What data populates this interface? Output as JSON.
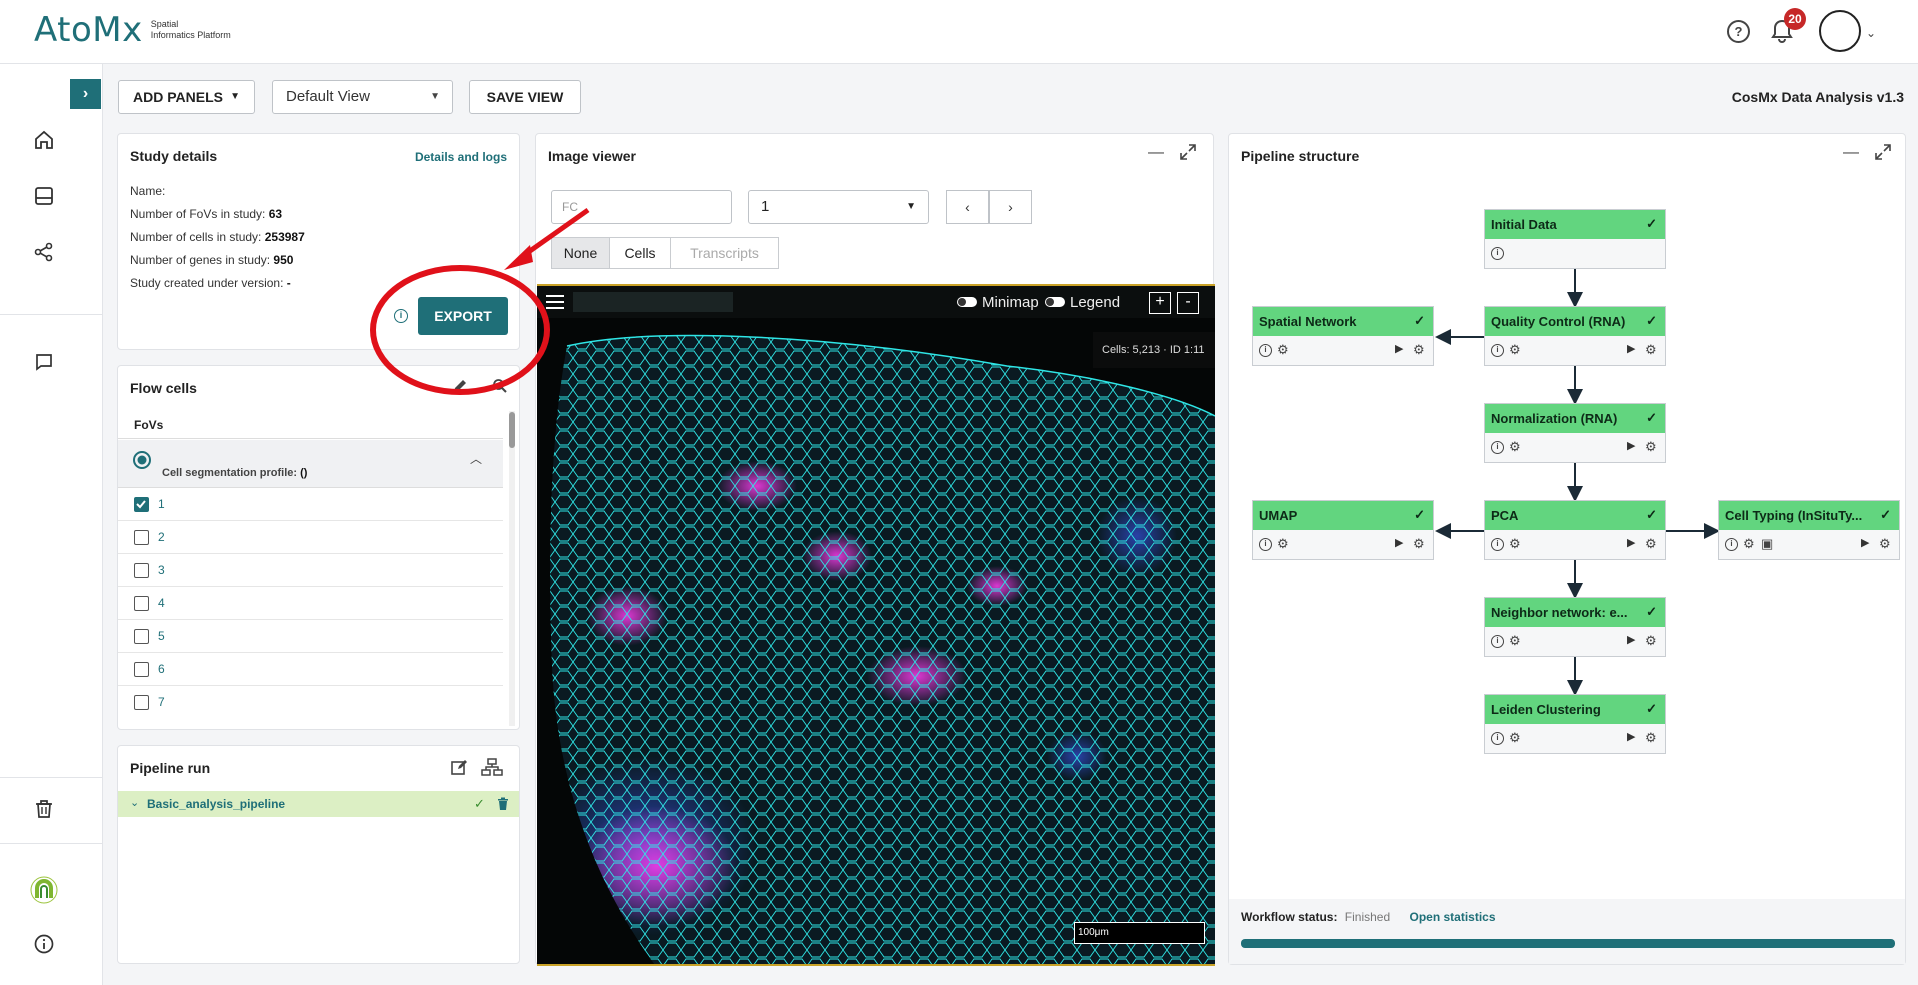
{
  "header": {
    "logo_text": "AtoMx",
    "logo_sub_line1": "Spatial",
    "logo_sub_line2": "Informatics Platform",
    "help_icon": "help-icon",
    "notification_count": "20"
  },
  "toolbar": {
    "add_panels_label": "ADD PANELS",
    "view_select_value": "Default View",
    "save_view_label": "SAVE VIEW",
    "app_version": "CosMx Data Analysis v1.3"
  },
  "study_details": {
    "title": "Study details",
    "details_link": "Details and logs",
    "name_label": "Name:",
    "fovs_label": "Number of FoVs in study:",
    "fovs_value": "63",
    "cells_label": "Number of cells in study:",
    "cells_value": "253987",
    "genes_label": "Number of genes in study:",
    "genes_value": "950",
    "version_label": "Study created under version:",
    "version_value": "-",
    "export_label": "EXPORT",
    "annotation_color": "#e0111a"
  },
  "flow_cells": {
    "title": "Flow cells",
    "column_header": "FoVs",
    "profile_label": "Cell segmentation profile:",
    "profile_value": "()",
    "fovs": [
      {
        "label": "1",
        "checked": true
      },
      {
        "label": "2",
        "checked": false
      },
      {
        "label": "3",
        "checked": false
      },
      {
        "label": "4",
        "checked": false
      },
      {
        "label": "5",
        "checked": false
      },
      {
        "label": "6",
        "checked": false
      },
      {
        "label": "7",
        "checked": false
      }
    ]
  },
  "pipeline_run": {
    "title": "Pipeline run",
    "pipeline_name": "Basic_analysis_pipeline"
  },
  "image_viewer": {
    "title": "Image viewer",
    "search_placeholder": "FC",
    "fov_select_value": "1",
    "prev_label": "‹",
    "next_label": "›",
    "segments": [
      "None",
      "Cells",
      "Transcripts"
    ],
    "active_segment": "None",
    "minimap_label": "Minimap",
    "legend_label": "Legend",
    "zoom_in": "+",
    "zoom_out": "-",
    "cells_tooltip": "Cells: 5,213 · ID 1:11",
    "scale_label": "100μm"
  },
  "pipeline_structure": {
    "title": "Pipeline structure",
    "nodes": [
      {
        "id": "initial",
        "label": "Initial Data"
      },
      {
        "id": "spatial",
        "label": "Spatial Network"
      },
      {
        "id": "qc",
        "label": "Quality Control (RNA)"
      },
      {
        "id": "norm",
        "label": "Normalization (RNA)"
      },
      {
        "id": "umap",
        "label": "UMAP"
      },
      {
        "id": "pca",
        "label": "PCA"
      },
      {
        "id": "celltype",
        "label": "Cell Typing (InSituTy..."
      },
      {
        "id": "neighbor",
        "label": "Neighbor network: e..."
      },
      {
        "id": "leiden",
        "label": "Leiden Clustering"
      }
    ],
    "workflow_status_label": "Workflow status:",
    "workflow_status_value": "Finished",
    "open_statistics_label": "Open statistics",
    "progress": 1.0
  },
  "colors": {
    "accent": "#1f6f78",
    "node_green": "#62d57f",
    "pipeline_row_bg": "#dcefc4"
  }
}
